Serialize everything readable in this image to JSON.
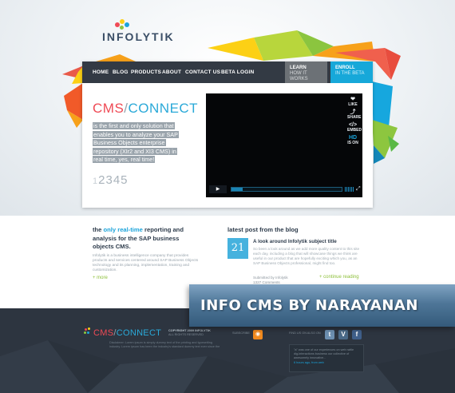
{
  "colors": {
    "nav_bg": "#333a44",
    "learn_bg": "#6c7176",
    "enroll_bg": "#17a8d9",
    "accent_blue": "#1aa3da",
    "accent_red": "#ef4a55",
    "link_green": "#8dbf3a",
    "footer_bg": "#2d3540",
    "banner_bg": "#4e7698"
  },
  "brand": {
    "logo_text": "INFOLYTIK"
  },
  "nav": {
    "items": [
      "HOME",
      "BLOG",
      "PRODUCTS",
      "ABOUT",
      "CONTACT US",
      "BETA LOGIN"
    ],
    "learn": {
      "line1": "LEARN",
      "line2": "HOW IT WORKS"
    },
    "enroll": {
      "line1": "ENROLL",
      "line2": "IN THE BETA"
    }
  },
  "hero": {
    "title_cms": "CMS",
    "title_slash": "/",
    "title_connect": "CONNECT",
    "description": "is the first and only solution that enables you to analyze your SAP Business Objects enterprise repository (XIr2 and XI3 CMS) in real time, yes, real time!",
    "pager": [
      "1",
      "2",
      "3",
      "4",
      "5"
    ]
  },
  "video": {
    "side": [
      {
        "icon": "heart-icon",
        "glyph": "❤",
        "label": "LIKE"
      },
      {
        "icon": "share-icon",
        "glyph": "⤴",
        "label": "SHARE"
      },
      {
        "icon": "embed-icon",
        "glyph": "</>",
        "label": "EMBED"
      },
      {
        "icon": "hd-icon",
        "glyph": "HD",
        "label": "IS ON"
      }
    ],
    "progress": 0.1
  },
  "about": {
    "heading_pre": "the",
    "heading_hl": "only real-time",
    "heading_post": "reporting and analysis for the SAP business objects CMS.",
    "text": "Infolytik is a business intelligence company that provides products and services centered around SAP Business Objects technology and its planning, implementation, training and customization.",
    "more": "+ more"
  },
  "blog": {
    "heading": "latest post from the blog",
    "date": "21",
    "post_title": "A look around Infolytik subject title",
    "post_text": "So been a look around as we add more quality content to this site each day, including a blog that will showcase things we think are useful in our product that are hopefully exciting which you, as an SAP Business Objects professional, might find too.",
    "by_line": "Submitted by Infolytik",
    "comments": "1327 Comments",
    "continue": "+ continue reading"
  },
  "banner": {
    "text": "INFO CMS BY NARAYANAN"
  },
  "footer": {
    "brand_cms": "CMS",
    "brand_slash": "/",
    "brand_connect": "CONNECT",
    "copyright": "COPYRIGHT 2009 INFOLYTIK",
    "rights": "ALL RIGHTS RESERVED",
    "description": "Disclaimer: Lorem ipsum is simply dummy text of the printing and typesetting industry. Lorem ipsum has been the industry's standard dummy text ever since the",
    "subscribe": "SUBSCRIBE",
    "find_us": "FIND US ON ALSO ON",
    "tweet": "\"a\" was one of our experiences on web rattle dig-interactions business our collective of awesomely innovative...",
    "tweet_meta": "6 hours ago, from web"
  }
}
